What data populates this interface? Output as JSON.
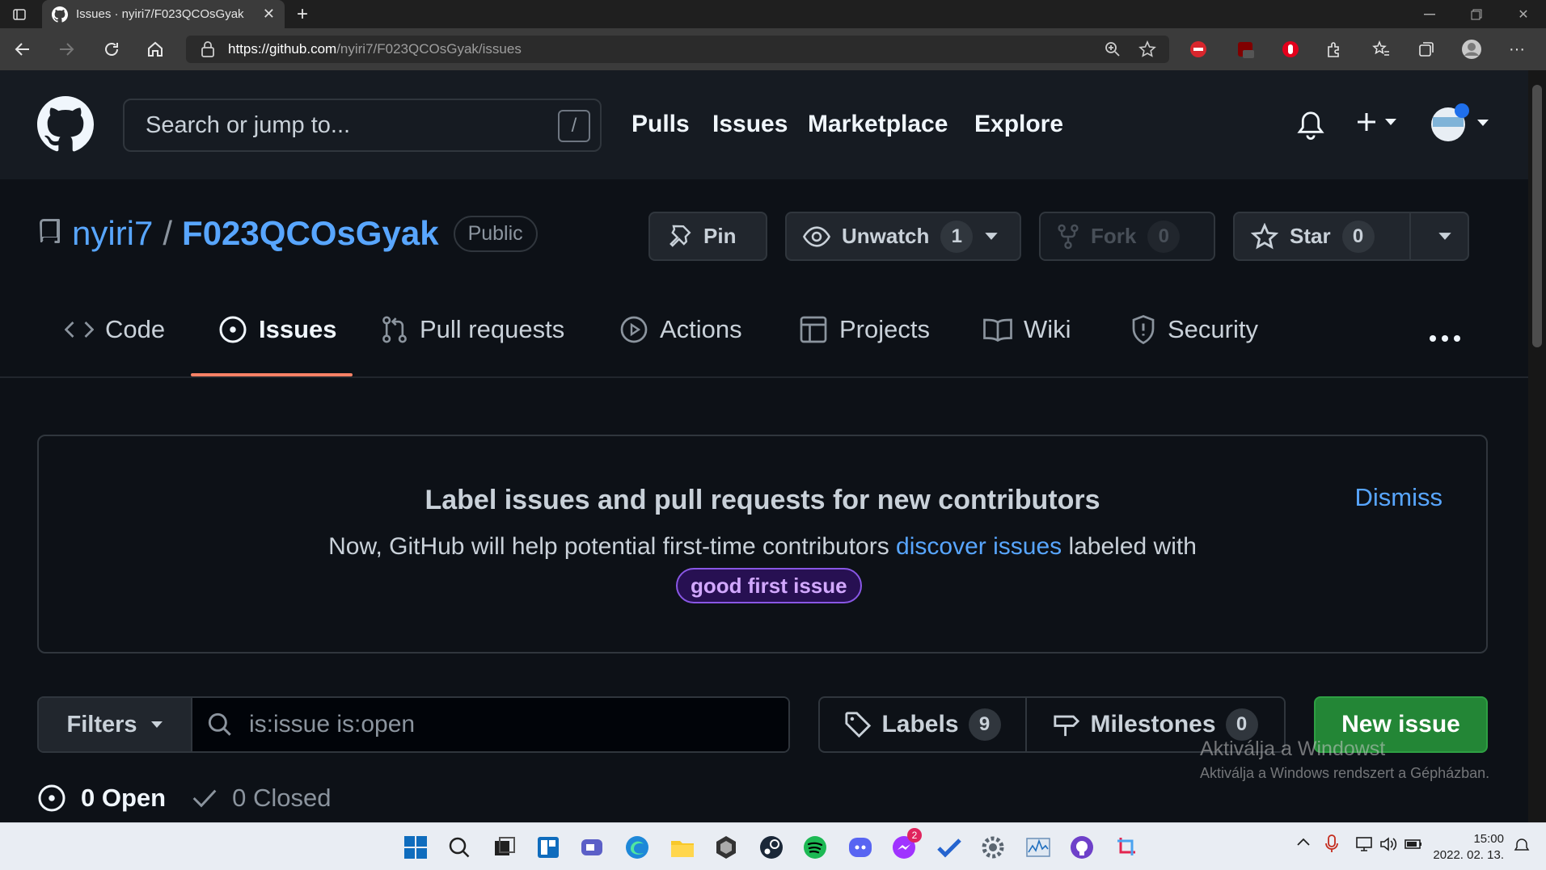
{
  "browser": {
    "tab_title": "Issues · nyiri7/F023QCOsGyak",
    "url_host": "https://github.com",
    "url_path": "/nyiri7/F023QCOsGyak/issues"
  },
  "header": {
    "search_placeholder": "Search or jump to...",
    "search_shortcut": "/",
    "nav": [
      "Pulls",
      "Issues",
      "Marketplace",
      "Explore"
    ]
  },
  "repo": {
    "owner": "nyiri7",
    "separator": "/",
    "name": "F023QCOsGyak",
    "visibility": "Public",
    "pin_label": "Pin",
    "unwatch_label": "Unwatch",
    "unwatch_count": "1",
    "fork_label": "Fork",
    "fork_count": "0",
    "star_label": "Star",
    "star_count": "0"
  },
  "tabs": [
    "Code",
    "Issues",
    "Pull requests",
    "Actions",
    "Projects",
    "Wiki",
    "Security"
  ],
  "banner": {
    "title": "Label issues and pull requests for new contributors",
    "text_before": "Now, GitHub will help potential first-time contributors ",
    "link": "discover issues",
    "text_after": " labeled with",
    "label": "good first issue",
    "dismiss": "Dismiss"
  },
  "filterbar": {
    "filters_label": "Filters",
    "query": "is:issue is:open",
    "labels_label": "Labels",
    "labels_count": "9",
    "milestones_label": "Milestones",
    "milestones_count": "0",
    "new_issue_label": "New issue"
  },
  "states": {
    "open": "0 Open",
    "closed": "0 Closed"
  },
  "watermark": {
    "line1": "Aktiválja a Windowst",
    "line2": "Aktiválja a Windows rendszert a Gépházban."
  },
  "taskbar": {
    "time": "15:00",
    "date": "2022. 02. 13.",
    "messenger_badge": "2"
  },
  "colors": {
    "accent_link": "#58a6ff",
    "primary_button": "#238636",
    "tab_underline": "#f78166"
  }
}
